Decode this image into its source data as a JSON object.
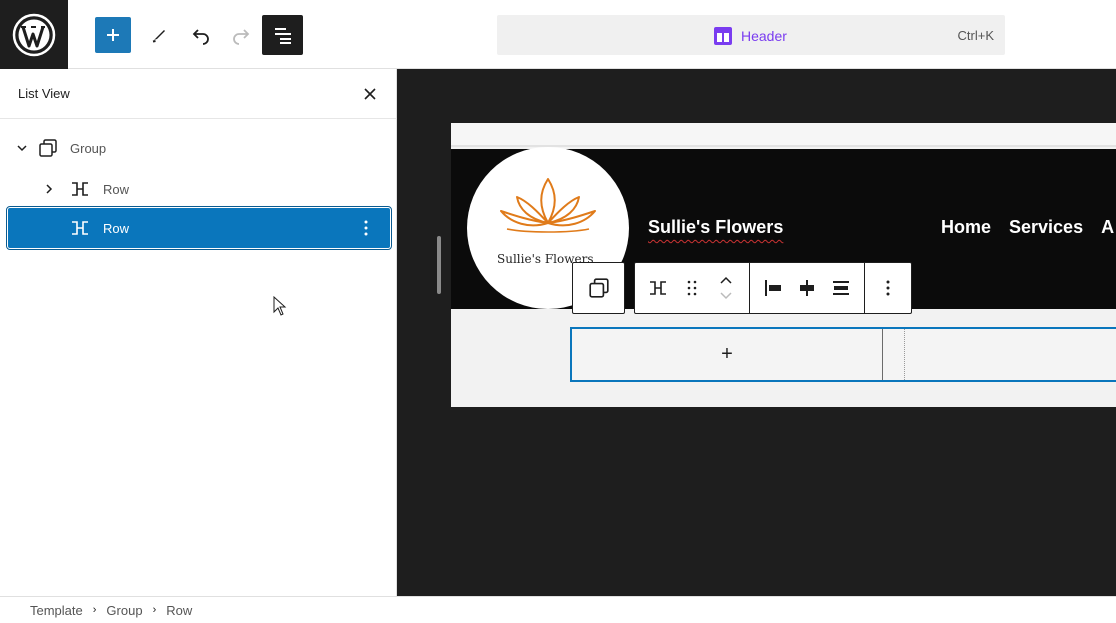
{
  "topbar": {
    "logo_icon": "wordpress-logo-icon",
    "add_icon": "plus-icon",
    "tools_icon": "pencil-icon",
    "undo_icon": "undo-icon",
    "redo_icon": "redo-icon",
    "listview_icon": "list-view-icon",
    "command": {
      "icon": "template-part-icon",
      "label": "Header",
      "shortcut": "Ctrl+K"
    }
  },
  "sidebar": {
    "title": "List View",
    "close_icon": "close-icon",
    "items": [
      {
        "label": "Group",
        "icon": "group-icon",
        "expanded": true
      },
      {
        "label": "Row",
        "icon": "row-icon",
        "expanded": false
      },
      {
        "label": "Row",
        "icon": "row-icon",
        "selected": true,
        "options_icon": "more-vertical-icon"
      }
    ]
  },
  "canvas": {
    "logo_text": "Sullie's Flowers",
    "site_title": "Sullie's Flowers",
    "nav": [
      "Home",
      "Services",
      "A"
    ],
    "row_add_label": "+",
    "colors": {
      "selected": "#0a76bc",
      "header_bg": "#0b0b0b",
      "logo_orange": "#e07b1a"
    }
  },
  "toolbar": {
    "parent_icon": "group-icon",
    "row_icon": "row-icon",
    "drag_icon": "drag-handle-icon",
    "move_up_icon": "chevron-up-icon",
    "move_down_icon": "chevron-down-icon",
    "justify_left_icon": "justify-left-icon",
    "justify_center_icon": "justify-center-icon",
    "justify_space_icon": "justify-space-between-icon",
    "more_icon": "more-vertical-icon"
  },
  "footer": {
    "breadcrumbs": [
      "Template",
      "Group",
      "Row"
    ]
  }
}
